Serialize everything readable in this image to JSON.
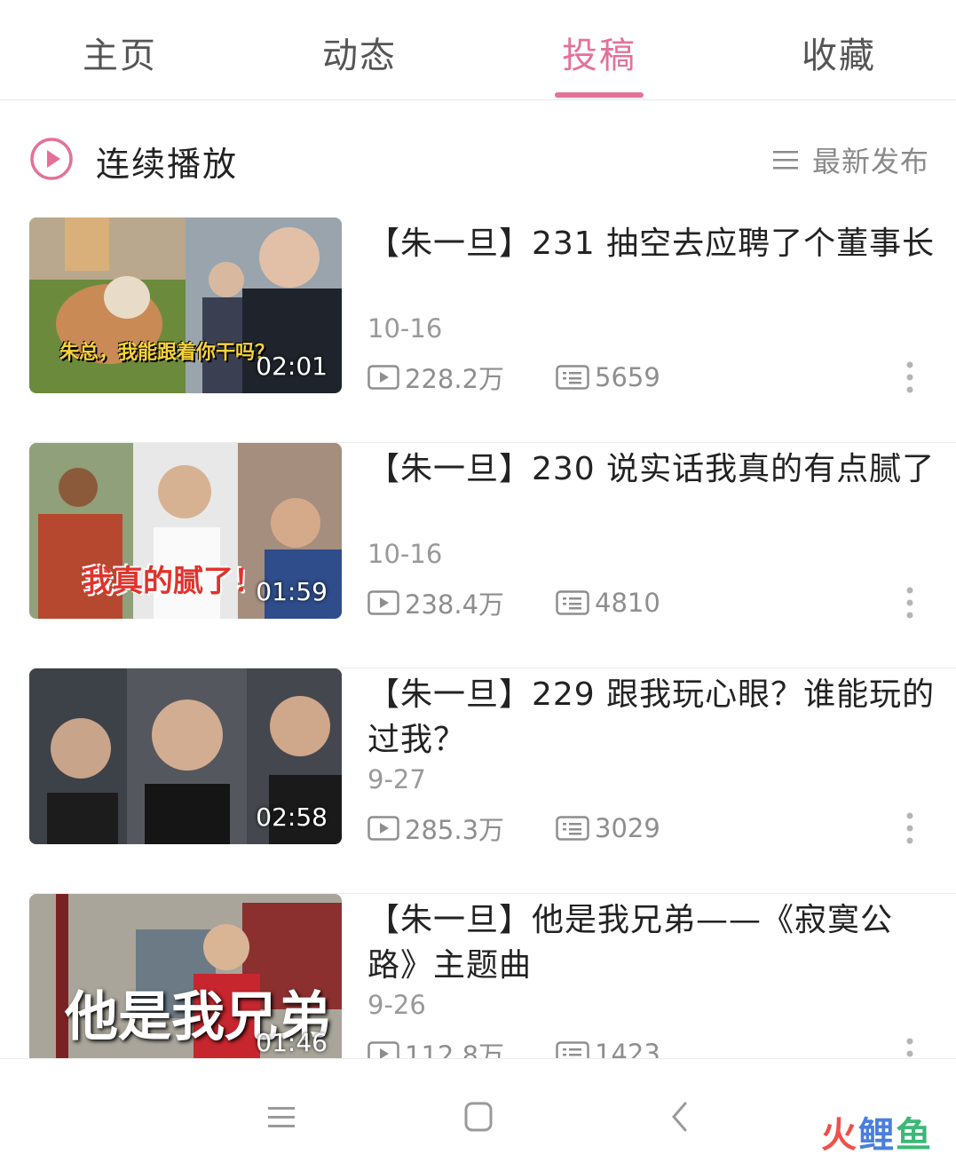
{
  "tabs": [
    {
      "label": "主页",
      "active": false
    },
    {
      "label": "动态",
      "active": false
    },
    {
      "label": "投稿",
      "active": true
    },
    {
      "label": "收藏",
      "active": false
    }
  ],
  "play_all": {
    "label": "连续播放",
    "icon": "play-circle-icon"
  },
  "sort": {
    "label": "最新发布",
    "icon": "list-sort-icon"
  },
  "videos": [
    {
      "title": "【朱一旦】231 抽空去应聘了个董事长",
      "date": "10-16",
      "views": "228.2万",
      "comments": "5659",
      "duration": "02:01",
      "thumb_caption": "朱总，我能跟着你干吗？"
    },
    {
      "title": "【朱一旦】230 说实话我真的有点腻了",
      "date": "10-16",
      "views": "238.4万",
      "comments": "4810",
      "duration": "01:59",
      "thumb_caption": "我真的腻了！"
    },
    {
      "title": "【朱一旦】229 跟我玩心眼？谁能玩的过我？",
      "date": "9-27",
      "views": "285.3万",
      "comments": "3029",
      "duration": "02:58",
      "thumb_caption": ""
    },
    {
      "title": "【朱一旦】他是我兄弟——《寂寞公路》主题曲",
      "date": "9-26",
      "views": "112.8万",
      "comments": "1423",
      "duration": "01:46",
      "thumb_caption": "他是我兄弟"
    }
  ],
  "nav": {
    "menu_icon": "menu-icon",
    "home_icon": "square-home-icon",
    "back_icon": "back-chevron-icon"
  },
  "watermark": {
    "part1": "火",
    "part2": "鲤",
    "part3": "鱼"
  },
  "colors": {
    "accent": "#e4719a",
    "text": "#222222",
    "muted": "#999999"
  }
}
